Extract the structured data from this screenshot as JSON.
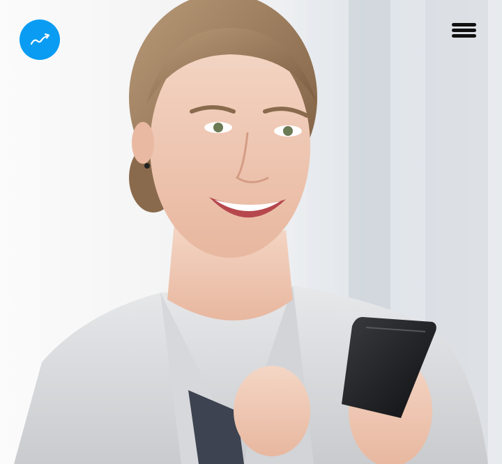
{
  "header": {
    "logo_icon": "signature-arrow-icon",
    "menu_icon": "hamburger-menu-icon"
  },
  "hero": {
    "image": "smiling-businesswoman-holding-smartphone"
  },
  "colors": {
    "brand": "#0a9cf3",
    "menu": "#111111"
  }
}
